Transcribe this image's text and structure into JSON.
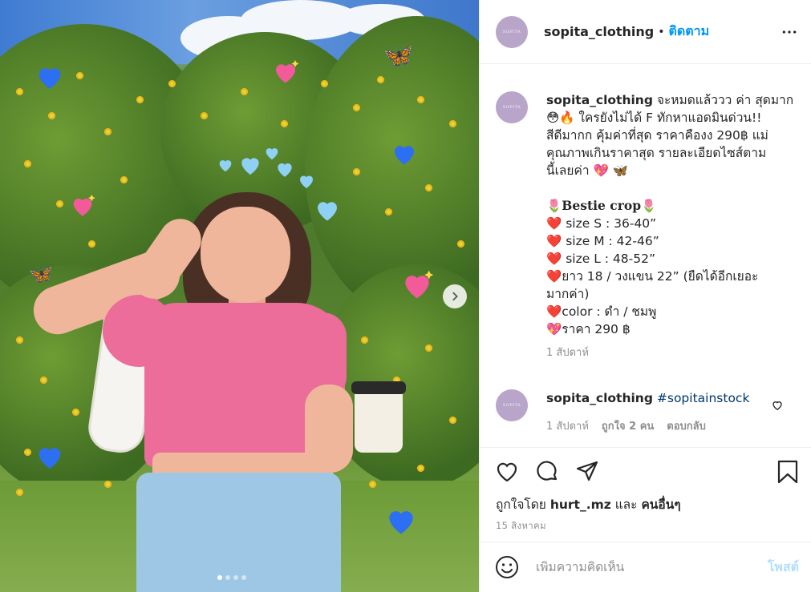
{
  "post": {
    "username": "sopita_clothing",
    "separator": "•",
    "follow_label": "ติดตาม",
    "avatar_text": "SOPITA",
    "carousel": {
      "total": 4,
      "active": 0
    }
  },
  "caption": {
    "username": "sopita_clothing",
    "lines": [
      " จะหมดแล้ววว ค่า สุดมาก",
      "😳🔥 ใครยังไม่ได้ F ทักหาแอดมินด่วน!!",
      "สีดีมากก คุ้มค่าที่สุด ราคาคืองง 290฿ แม่",
      "คุณภาพเกินราคาสุด รายละเอียดไซส์ตาม",
      "นี้เลยค่า 💖 🦋",
      "",
      "🌷𝐁𝐞𝐬𝐭𝐢𝐞 𝐜𝐫𝐨𝐩🌷",
      "❤️ size S : 36-40”",
      "❤️ size M : 42-46”",
      "❤️ size L : 48-52”",
      "❤️ยาว 18 / วงแขน 22” (ยืดได้อีกเยอะ",
      "มากค่า)",
      "❤️color : ดำ / ชมพู",
      "💖ราคา 290 ฿"
    ],
    "time": "1 สัปดาห์"
  },
  "comment": {
    "username": "sopita_clothing",
    "text": "#sopitainstock",
    "time": "1 สัปดาห์",
    "likes": "ถูกใจ 2 คน",
    "reply_label": "ตอบกลับ"
  },
  "likes_line": {
    "prefix": "ถูกใจโดย ",
    "user": "hurt_.mz",
    "middle": " และ ",
    "others": "คนอื่นๆ"
  },
  "date": "15 สิงหาคม",
  "add_comment": {
    "placeholder": "เพิ่มความคิดเห็น",
    "post_label": "โพสต์"
  },
  "icons": {
    "more": "more-options-icon",
    "like": "heart-icon",
    "comment": "comment-icon",
    "share": "paper-plane-icon",
    "save": "bookmark-icon",
    "emoji": "smiley-icon",
    "next": "chevron-right-icon"
  },
  "colors": {
    "accent": "#0095f6",
    "post_disabled": "#b2dffc",
    "avatar": "#b9a5c9",
    "meta": "#8e8e8e"
  }
}
